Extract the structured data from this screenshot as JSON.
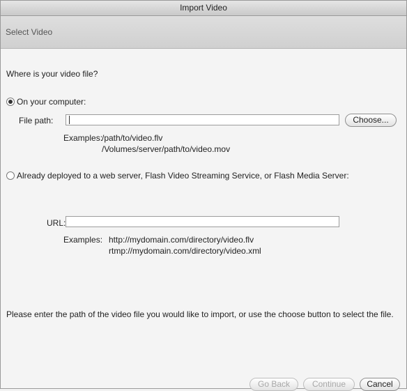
{
  "window": {
    "title": "Import Video"
  },
  "header": {
    "title": "Select Video"
  },
  "main": {
    "question": "Where is your video file?",
    "local_option": {
      "label": "On your computer:",
      "selected": true,
      "file_path_label": "File path:",
      "file_path_value": "",
      "choose_label": "Choose...",
      "examples_label": "Examples:",
      "examples": [
        "/path/to/video.flv",
        "/Volumes/server/path/to/video.mov"
      ]
    },
    "server_option": {
      "label": "Already deployed to a web server, Flash Video Streaming Service, or Flash Media Server:",
      "selected": false,
      "url_label": "URL:",
      "url_value": "",
      "examples_label": "Examples:",
      "examples": [
        "http://mydomain.com/directory/video.flv",
        "rtmp://mydomain.com/directory/video.xml"
      ]
    },
    "instruction": "Please enter the path of the video file you would like to import, or use the choose button to select the file."
  },
  "footer": {
    "go_back_label": "Go Back",
    "continue_label": "Continue",
    "cancel_label": "Cancel"
  }
}
